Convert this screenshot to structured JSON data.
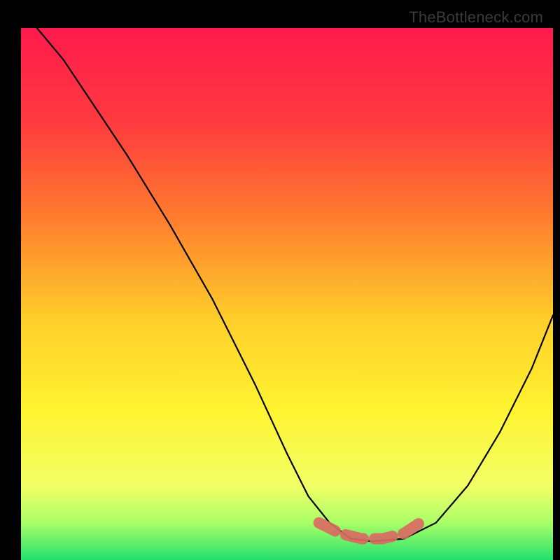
{
  "attribution": "TheBottleneck.com",
  "chart_data": {
    "type": "line",
    "title": "",
    "xlabel": "",
    "ylabel": "",
    "xlim": [
      0,
      100
    ],
    "ylim": [
      0,
      100
    ],
    "gradient_stops": [
      {
        "offset": 0,
        "color": "#ff1a4d"
      },
      {
        "offset": 18,
        "color": "#ff3b3f"
      },
      {
        "offset": 35,
        "color": "#ff7a2e"
      },
      {
        "offset": 55,
        "color": "#ffcf2a"
      },
      {
        "offset": 72,
        "color": "#fff431"
      },
      {
        "offset": 86,
        "color": "#f2ff66"
      },
      {
        "offset": 93,
        "color": "#aaff66"
      },
      {
        "offset": 100,
        "color": "#22e06e"
      }
    ],
    "series": [
      {
        "name": "curve",
        "x": [
          3,
          8,
          14,
          20,
          28,
          36,
          44,
          50,
          54,
          58,
          62,
          66,
          72,
          78,
          84,
          90,
          96,
          100
        ],
        "y": [
          100,
          94,
          85,
          76,
          63,
          49,
          33,
          20,
          12,
          7,
          4,
          3.5,
          4,
          7,
          14,
          24,
          36,
          46
        ]
      },
      {
        "name": "optimal-band",
        "x": [
          56,
          60,
          64,
          68,
          72,
          75
        ],
        "y": [
          7,
          5,
          4,
          4,
          5,
          7
        ]
      }
    ]
  }
}
